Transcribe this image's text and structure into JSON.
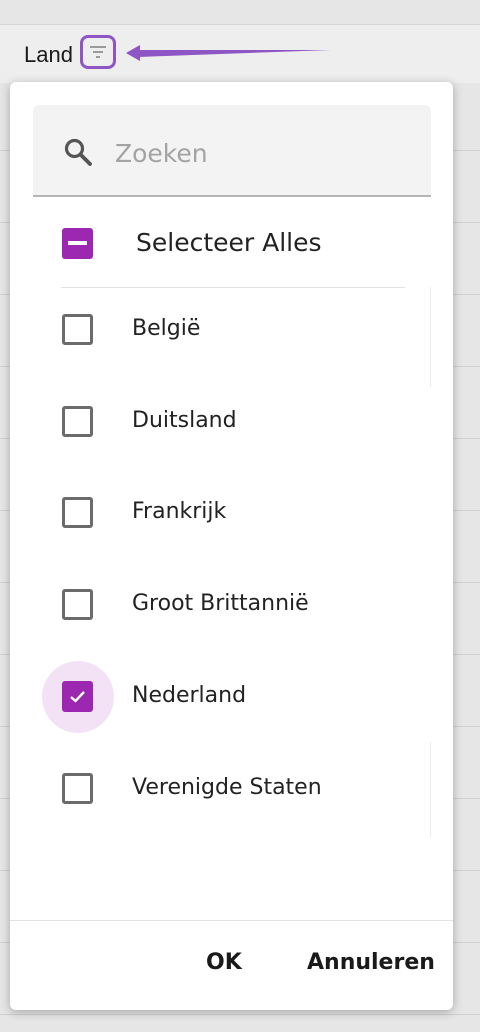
{
  "header": {
    "column_label": "Land"
  },
  "search": {
    "placeholder": "Zoeken",
    "value": ""
  },
  "select_all": {
    "label": "Selecteer Alles",
    "state": "indeterminate"
  },
  "options": [
    {
      "label": "België",
      "checked": false
    },
    {
      "label": "Duitsland",
      "checked": false
    },
    {
      "label": "Frankrijk",
      "checked": false
    },
    {
      "label": "Groot Brittannië",
      "checked": false
    },
    {
      "label": "Nederland",
      "checked": true
    },
    {
      "label": "Verenigde Staten",
      "checked": false
    }
  ],
  "footer": {
    "ok_label": "OK",
    "cancel_label": "Annuleren"
  },
  "colors": {
    "accent": "#9c27b0",
    "highlight": "#8e55c4"
  }
}
